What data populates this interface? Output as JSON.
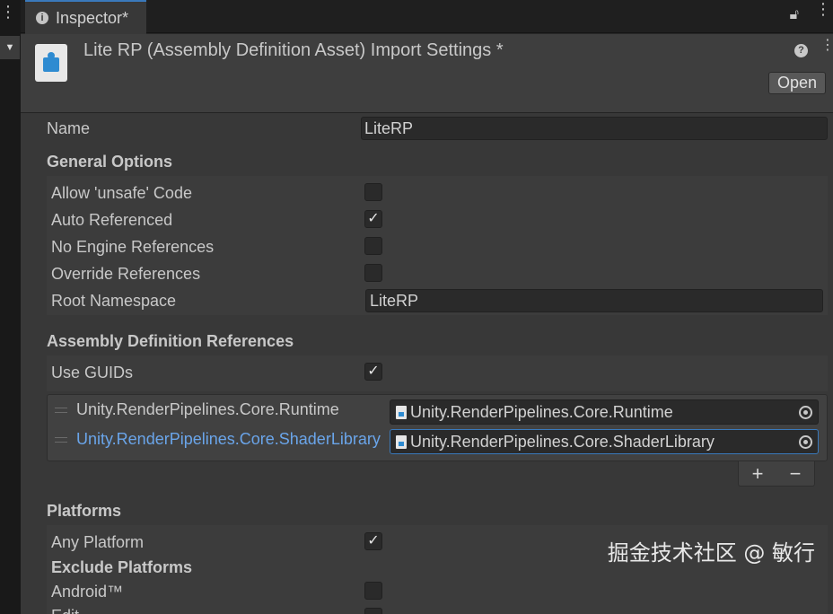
{
  "tab": {
    "title": "Inspector*"
  },
  "header": {
    "title": "Lite RP (Assembly Definition Asset) Import Settings *",
    "open_label": "Open"
  },
  "name_row": {
    "label": "Name",
    "value": "LiteRP"
  },
  "general_options": {
    "title": "General Options",
    "allow_unsafe": {
      "label": "Allow 'unsafe' Code",
      "checked": false
    },
    "auto_referenced": {
      "label": "Auto Referenced",
      "checked": true
    },
    "no_engine_refs": {
      "label": "No Engine References",
      "checked": false
    },
    "override_refs": {
      "label": "Override References",
      "checked": false
    },
    "root_namespace": {
      "label": "Root Namespace",
      "value": "LiteRP"
    }
  },
  "assembly_refs": {
    "title": "Assembly Definition References",
    "use_guids": {
      "label": "Use GUIDs",
      "checked": true
    },
    "items": [
      {
        "label": "Unity.RenderPipelines.Core.Runtime",
        "value": "Unity.RenderPipelines.Core.Runtime"
      },
      {
        "label": "Unity.RenderPipelines.Core.ShaderLibrary",
        "value": "Unity.RenderPipelines.Core.ShaderLibrary"
      }
    ],
    "add_label": "+",
    "remove_label": "−"
  },
  "platforms": {
    "title": "Platforms",
    "any_platform": {
      "label": "Any Platform",
      "checked": true
    },
    "exclude_title": "Exclude Platforms",
    "android": {
      "label": "Android™",
      "checked": false
    },
    "editor_partial": "Edit"
  },
  "check_glyph": "✓",
  "watermark": "掘金技术社区 @ 敏行",
  "colors": {
    "accent": "#3a79bb",
    "selected_text": "#6aa5ea",
    "background": "#383838"
  }
}
